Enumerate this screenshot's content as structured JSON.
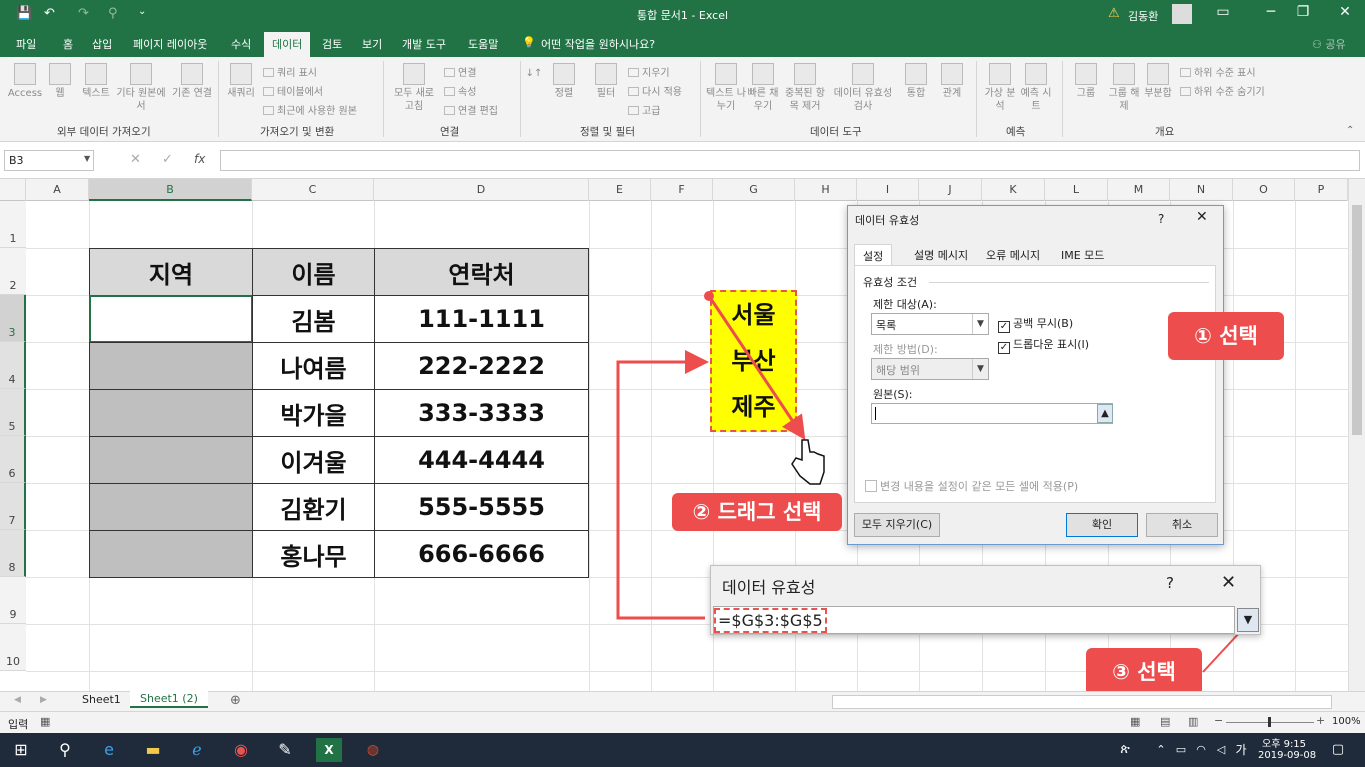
{
  "title_bar": {
    "title": "통합 문서1  -  Excel",
    "user": "김동환"
  },
  "tabs": [
    "파일",
    "홈",
    "삽입",
    "페이지 레이아웃",
    "수식",
    "데이터",
    "검토",
    "보기",
    "개발 도구",
    "도움말",
    "어떤 작업을 원하시나요?",
    "공유"
  ],
  "ribbon": {
    "get_external": {
      "label": "외부 데이터 가져오기",
      "items": [
        "Access",
        "웹",
        "텍스트",
        "기타 원본에서",
        "기존 연결"
      ]
    },
    "get_transform": {
      "label": "가져오기 및 변환",
      "big": "새쿼리",
      "small": [
        "쿼리 표시",
        "테이블에서",
        "최근에 사용한 원본"
      ]
    },
    "connections": {
      "label": "연결",
      "big": "모두 새로 고침",
      "small": [
        "연결",
        "속성",
        "연결 편집"
      ]
    },
    "sort_filter": {
      "label": "정렬 및 필터",
      "big": [
        "정렬",
        "필터"
      ],
      "small": [
        "지우기",
        "다시 적용",
        "고급"
      ]
    },
    "data_tools": {
      "label": "데이터 도구",
      "items": [
        "텍스트 나누기",
        "빠른 채우기",
        "중복된 항목 제거",
        "데이터 유효성 검사",
        "통합",
        "관계"
      ]
    },
    "forecast": {
      "label": "예측",
      "items": [
        "가상 분석",
        "예측 시트"
      ]
    },
    "outline": {
      "label": "개요",
      "items": [
        "그룹",
        "그룹 해제",
        "부분합"
      ],
      "small": [
        "하위 수준 표시",
        "하위 수준 숨기기"
      ]
    }
  },
  "formula_bar": {
    "name_box": "B3",
    "fx": "fx",
    "value": ""
  },
  "columns": [
    "A",
    "B",
    "C",
    "D",
    "E",
    "F",
    "G",
    "H",
    "I",
    "J",
    "K",
    "L",
    "M",
    "N",
    "O",
    "P"
  ],
  "rows": [
    "1",
    "2",
    "3",
    "4",
    "5",
    "6",
    "7",
    "8",
    "9",
    "10"
  ],
  "table": {
    "headers": [
      "지역",
      "이름",
      "연락처"
    ],
    "names": [
      "김봄",
      "나여름",
      "박가을",
      "이겨울",
      "김환기",
      "홍나무"
    ],
    "phones": [
      "111-1111",
      "222-2222",
      "333-3333",
      "444-4444",
      "555-5555",
      "666-6666"
    ]
  },
  "list_source": [
    "서울",
    "부산",
    "제주"
  ],
  "dialog": {
    "title": "데이터 유효성",
    "help": "?",
    "tabs": [
      "설정",
      "설명 메시지",
      "오류 메시지",
      "IME 모드"
    ],
    "section": "유효성 조건",
    "allow_label": "제한 대상(A):",
    "allow_value": "목록",
    "data_label": "제한 방법(D):",
    "data_value": "해당 범위",
    "ignore_blank": "공백 무시(B)",
    "in_cell_dropdown": "드롭다운 표시(I)",
    "source_label": "원본(S):",
    "apply_all": "변경 내용을 설정이 같은 모든 셀에 적용(P)",
    "clear_all": "모두 지우기(C)",
    "ok": "확인",
    "cancel": "취소"
  },
  "mini_dialog": {
    "title": "데이터 유효성",
    "help": "?",
    "value": "=$G$3:$G$5"
  },
  "callouts": {
    "one": "① 선택",
    "two": "② 드래그 선택",
    "three": "③ 선택"
  },
  "colors": {
    "excel_green": "#217346",
    "callout_red": "#ee4d4d",
    "highlight_yellow": "#ffff00"
  },
  "sheets": [
    "Sheet1",
    "Sheet1 (2)"
  ],
  "status": {
    "mode": "입력",
    "zoom": "100%"
  },
  "taskbar": {
    "time": "오후 9:15",
    "date": "2019-09-08",
    "ime": "가"
  }
}
